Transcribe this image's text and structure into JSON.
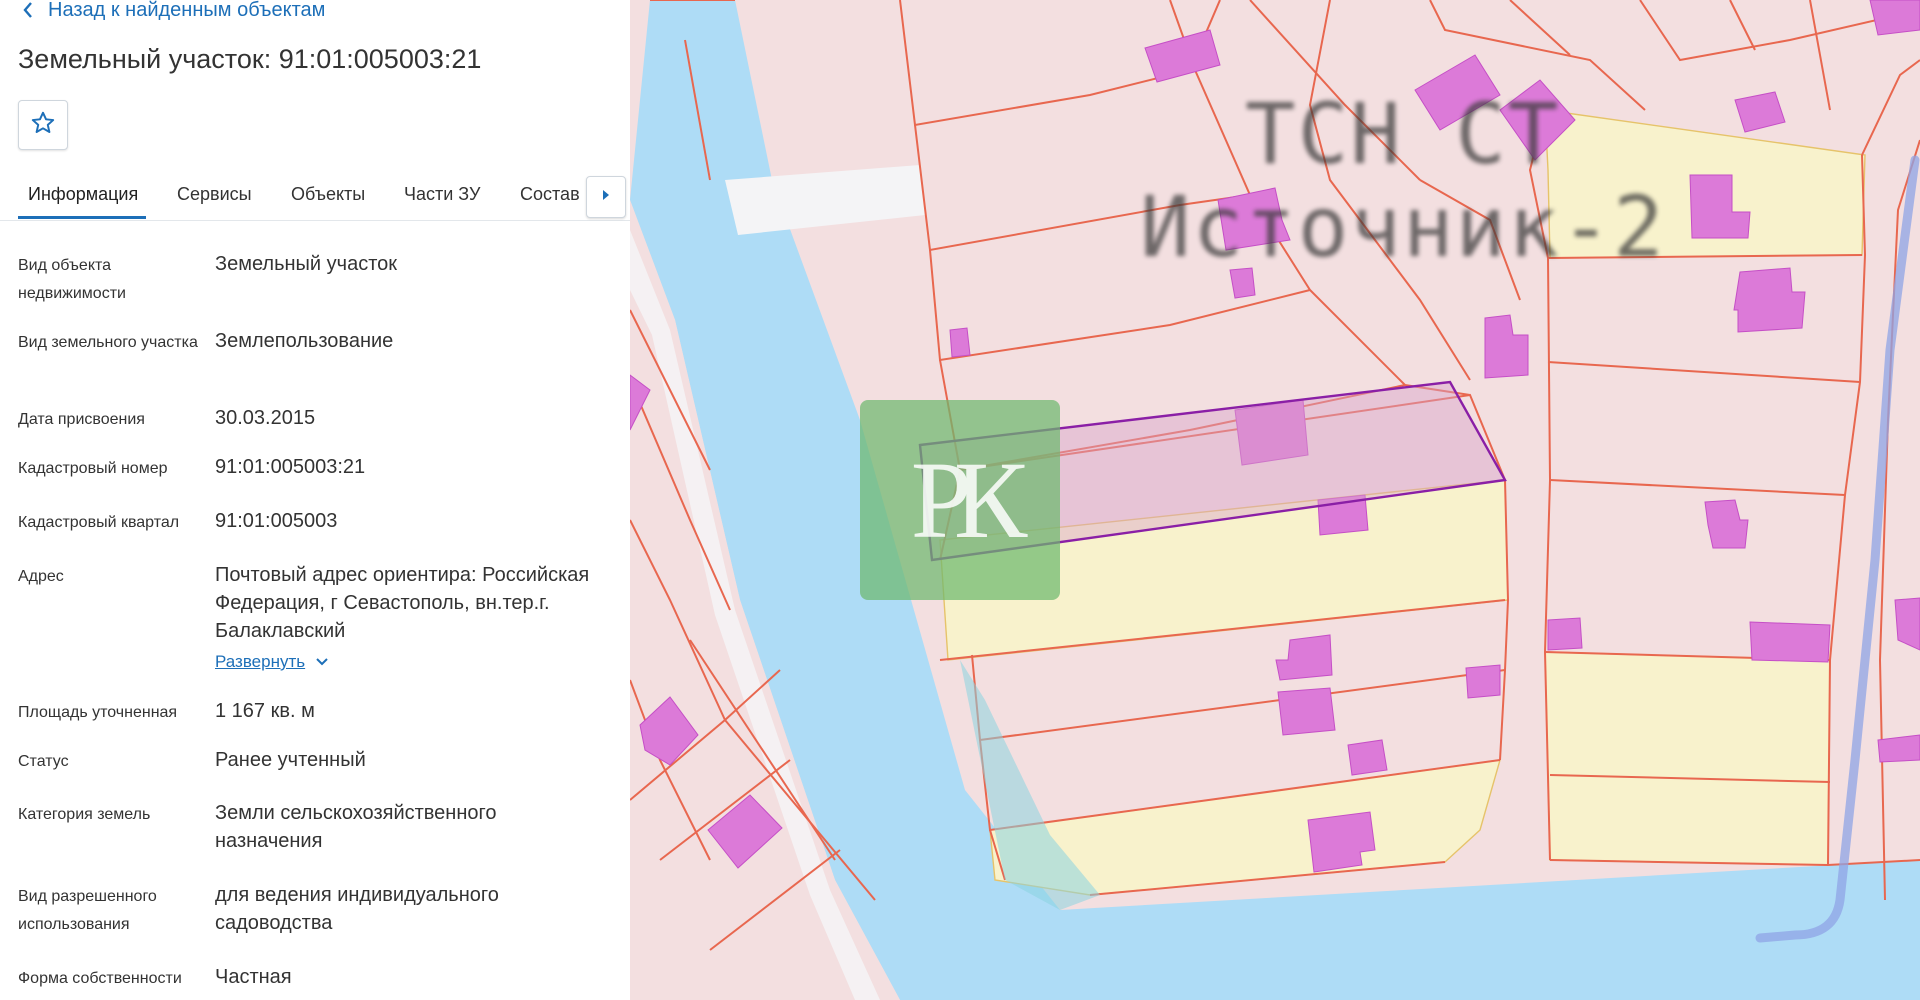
{
  "back_link": "Назад к найденным объектам",
  "title": "Земельный участок: 91:01:005003:21",
  "tabs": [
    "Информация",
    "Сервисы",
    "Объекты",
    "Части ЗУ",
    "Состав"
  ],
  "details": [
    {
      "label": "Вид объекта недвижимости",
      "value": "Земельный участок"
    },
    {
      "label": "Вид земельного участка",
      "value": "Землепользование"
    },
    {
      "label": "Дата присвоения",
      "value": "30.03.2015"
    },
    {
      "label": "Кадастровый номер",
      "value": "91:01:005003:21"
    },
    {
      "label": "Кадастровый квартал",
      "value": "91:01:005003"
    },
    {
      "label": "Адрес",
      "value": "Почтовый адрес ориентира: Российская Федерация, г Севастополь, вн.тер.г. Балаклавский"
    },
    {
      "label": "Площадь уточненная",
      "value": "1 167 кв. м"
    },
    {
      "label": "Статус",
      "value": "Ранее учтенный"
    },
    {
      "label": "Категория земель",
      "value": "Земли сельскохозяйственного назначения"
    },
    {
      "label": "Вид разрешенного использования",
      "value": "для ведения индивидуального садоводства"
    },
    {
      "label": "Форма собственности",
      "value": "Частная"
    }
  ],
  "expand_label": "Развернуть",
  "map": {
    "label_line1": "ТСН СТ",
    "label_line2": "Источник-2",
    "watermark": "РК"
  },
  "colors": {
    "accent": "#1d6fb8",
    "parcel_fill": "#f3dfe0",
    "parcel_border": "#e8674f",
    "water": "#aedcf6",
    "building": "#dc7ad8",
    "yellow_parcel": "#f8f2cc",
    "selected_border": "#8a1fa6",
    "watermark": "#6eb96e"
  }
}
